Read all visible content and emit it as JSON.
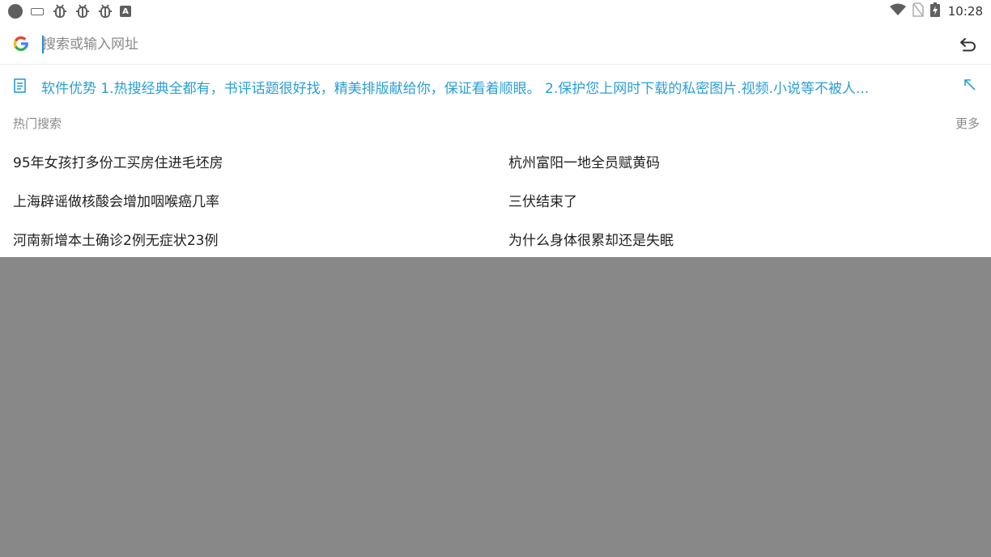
{
  "status_bar": {
    "time": "10:28",
    "left_icons": [
      "record-dot-icon",
      "keyboard-icon",
      "bug-icon",
      "bug-icon",
      "bug-icon",
      "a-icon"
    ],
    "right_icons": [
      "wifi-icon",
      "no-sim-icon",
      "battery-charging-icon"
    ]
  },
  "search": {
    "placeholder": "搜索或输入网址",
    "value": ""
  },
  "notice": {
    "text": "软件优势  1.热搜经典全都有，书评话题很好找，精美排版献给你，保证看着顺眼。    2.保护您上网时下载的私密图片.视频.小说等不被人..."
  },
  "hot_search": {
    "title": "热门搜索",
    "more_label": "更多",
    "items": [
      "95年女孩打多份工买房住进毛坯房",
      "杭州富阳一地全员赋黄码",
      "上海辟谣做核酸会增加咽喉癌几率",
      "三伏结束了",
      "河南新增本土确诊2例无症状23例",
      "为什么身体很累却还是失眠"
    ]
  },
  "colors": {
    "accent": "#2a9fd6",
    "overlay": "#888888",
    "text": "#212121",
    "muted": "#8a8a8a"
  }
}
